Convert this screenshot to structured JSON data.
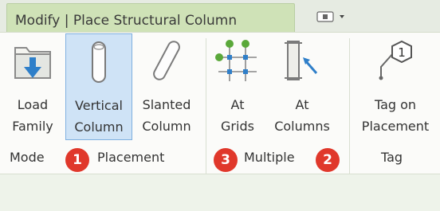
{
  "tab": {
    "label": "Modify | Place Structural Column"
  },
  "panel_toggle": {
    "icon": "panel-dropdown-icon"
  },
  "tools": [
    {
      "id": "load-family",
      "line1": "Load",
      "line2": "Family",
      "icon": "load-family-icon",
      "selected": false
    },
    {
      "id": "vertical-column",
      "line1": "Vertical",
      "line2": "Column",
      "icon": "vertical-column-icon",
      "selected": true
    },
    {
      "id": "slanted-column",
      "line1": "Slanted",
      "line2": "Column",
      "icon": "slanted-column-icon",
      "selected": false
    },
    {
      "id": "at-grids",
      "line1": "At",
      "line2": "Grids",
      "icon": "at-grids-icon",
      "selected": false
    },
    {
      "id": "at-columns",
      "line1": "At",
      "line2": "Columns",
      "icon": "at-columns-icon",
      "selected": false
    },
    {
      "id": "tag-on-placement",
      "line1": "Tag on",
      "line2": "Placement",
      "icon": "tag-icon",
      "selected": false
    }
  ],
  "panels": {
    "mode": "Mode",
    "placement": "Placement",
    "multiple": "Multiple",
    "tag": "Tag"
  },
  "badges": [
    "1",
    "3",
    "2"
  ],
  "colors": {
    "tab_active": "#cfe2b7",
    "selected_tool": "#cfe3f6",
    "badge": "#e0382b",
    "icon_blue": "#2f7fc9",
    "icon_green": "#5aa83a"
  }
}
